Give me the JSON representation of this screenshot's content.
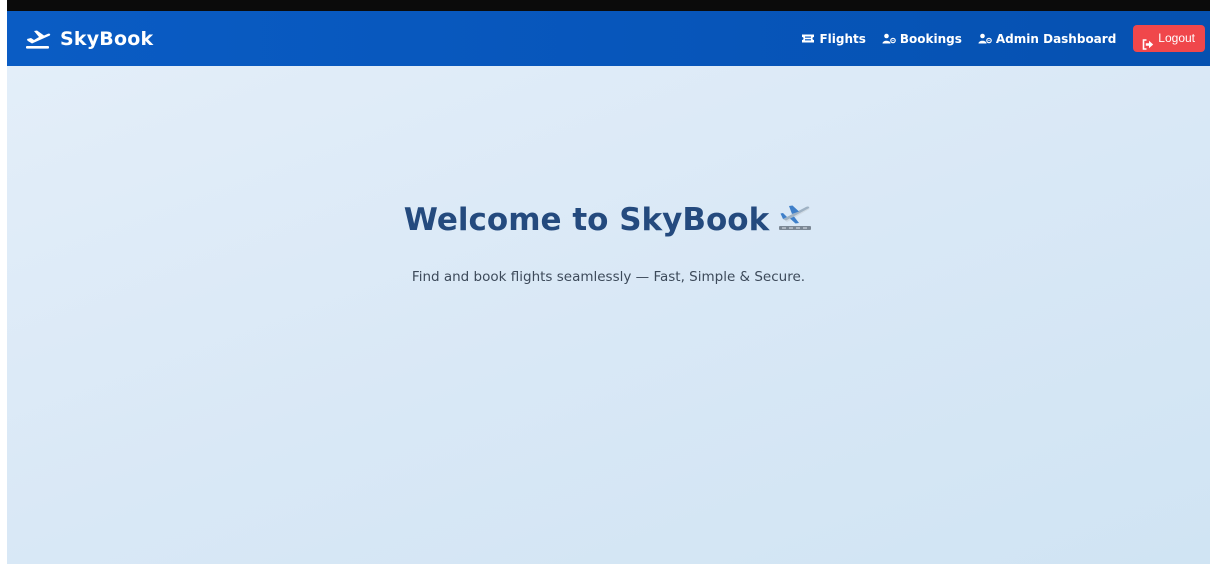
{
  "navbar": {
    "brand": "SkyBook",
    "brand_icon": "airplane-takeoff-icon",
    "links": [
      {
        "label": "Flights",
        "icon": "ticket-icon"
      },
      {
        "label": "Bookings",
        "icon": "users-icon"
      },
      {
        "label": "Admin Dashboard",
        "icon": "user-cog-icon"
      }
    ],
    "logout": {
      "label": "Logout",
      "icon": "sign-out-icon"
    }
  },
  "hero": {
    "title": "Welcome to SkyBook",
    "title_icon": "airplane-emoji",
    "subtitle": "Find and book flights seamlessly — Fast, Simple & Secure."
  },
  "colors": {
    "navbar": "#0a5cc4",
    "logout": "#f0474b",
    "title": "#244a7e",
    "background": "#dbe9f6"
  }
}
